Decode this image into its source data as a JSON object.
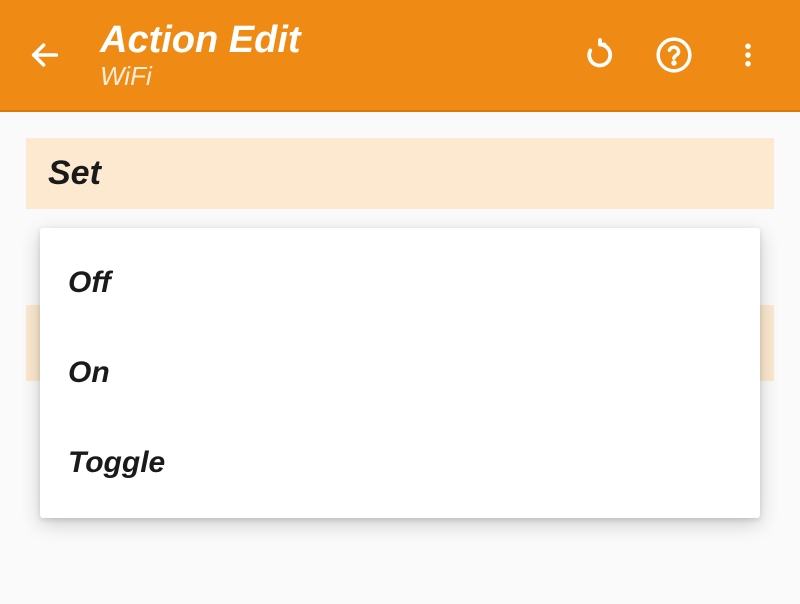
{
  "header": {
    "title": "Action Edit",
    "subtitle": "WiFi"
  },
  "section": {
    "label": "Set"
  },
  "dropdown": {
    "options": [
      "Off",
      "On",
      "Toggle"
    ]
  },
  "colors": {
    "primary": "#ef8b15",
    "labelBg": "#fce9cf"
  }
}
